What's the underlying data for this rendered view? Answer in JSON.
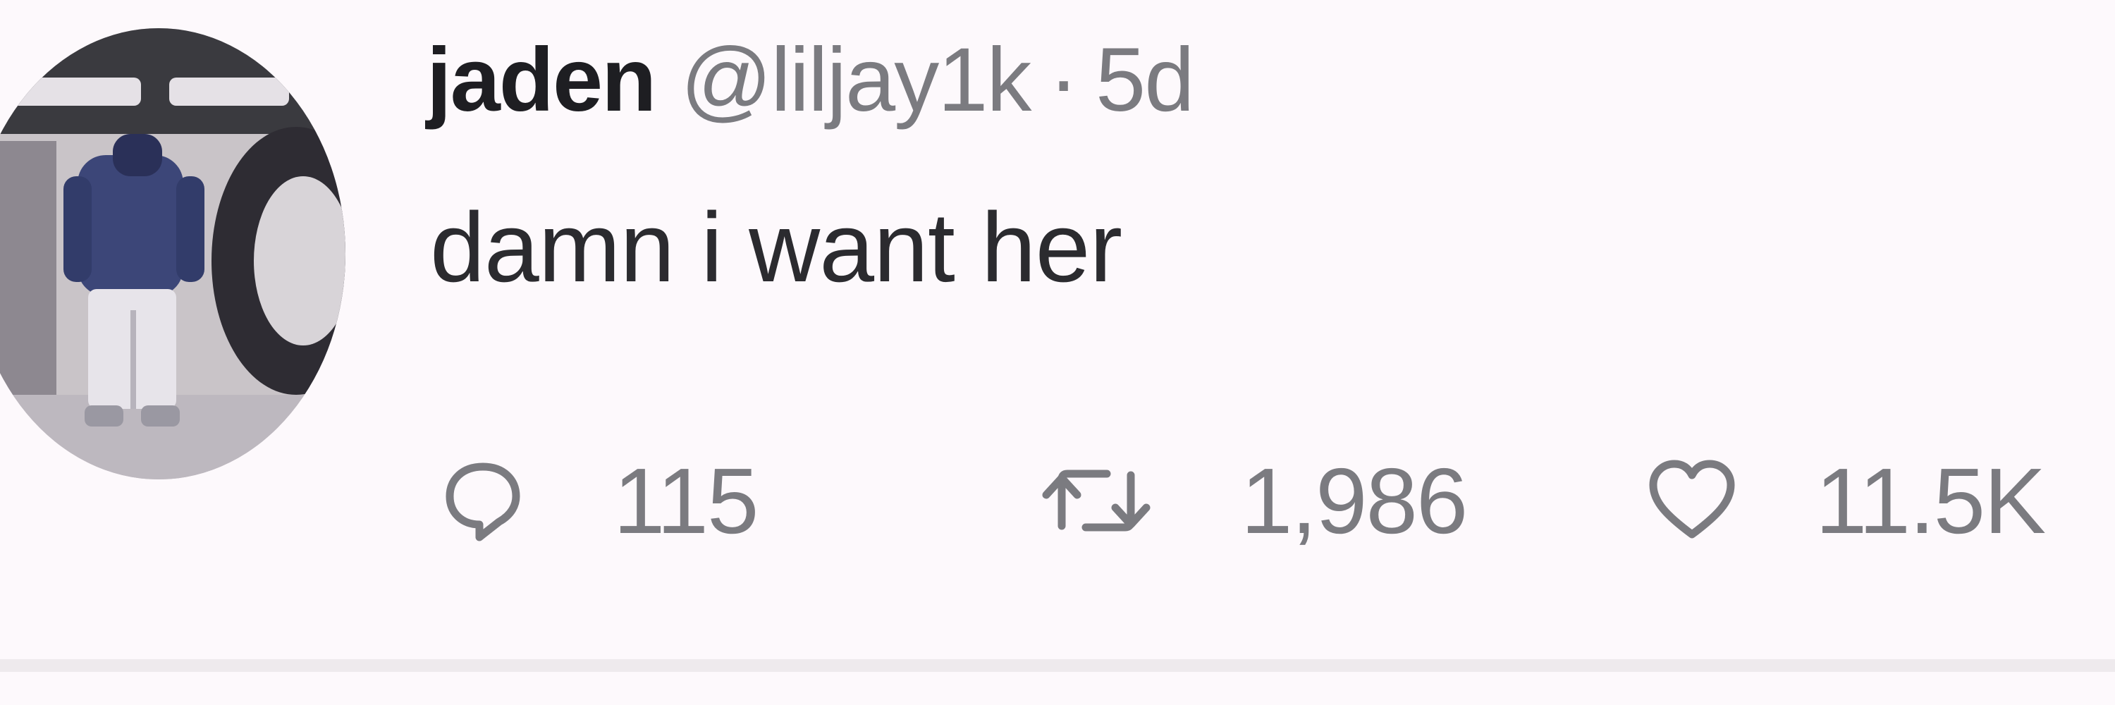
{
  "tweet": {
    "author": {
      "display_name": "jaden",
      "handle": "@liljay1k",
      "separator": "·",
      "time_ago": "5d"
    },
    "text": "damn i want her",
    "actions": {
      "reply": {
        "icon": "reply-icon",
        "count": "115"
      },
      "retweet": {
        "icon": "retweet-icon",
        "count": "1,986"
      },
      "like": {
        "icon": "heart-icon",
        "count": "11.5K"
      }
    }
  },
  "colors": {
    "background": "#fdf9fc",
    "name": "#1e1e22",
    "muted": "#7b7b80",
    "text": "#2b2b2f"
  }
}
